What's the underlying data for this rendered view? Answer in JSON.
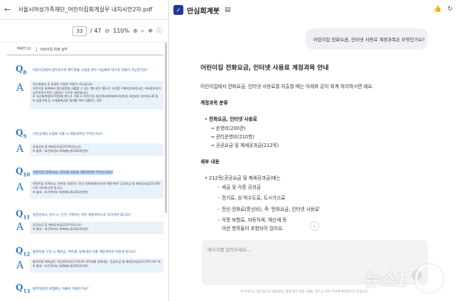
{
  "pdf": {
    "back_icon": "arrow-left-icon",
    "file_name": "서울시여성가족재단_어린이집회계실무 내치시안2차.pdf",
    "page_current": "33",
    "page_total": "/ 47",
    "zoom": "110%",
    "doc_header": {
      "part": "PART 02",
      "section": "어린이집 회계 실무"
    },
    "items": [
      {
        "q": "8",
        "question": "어린이집에서 업무용으로 핸드폰을 사용할 경우 이용료로 지기과 지출이 가능한가요?",
        "answer": [
          "안산회에서 휴 휴대폰 이용료 이용이 가능합니다.",
          "어린이집 회계에서 할인용품을 지출할 수 있는 핸드폰은 별도로 기기를 구매하신에게 되는 가비관리자가",
          "업무목적으로만 사용하는 기기로 제한됩니다.",
          "※ 지신회계에(271항)에 핸드폰 구매 시 어린이집 개선(특하회에회이리면)에 포함되어 관리하도록 합",
          "※ 상품구매 등 시계결제금을 협의를 하여 지출하는 경우"
        ]
      },
      {
        "q": "9",
        "question": "안전공제회 보험료 지출 시 계정과목은 무엇인가요?",
        "answer": [
          "공과금의 및 제세공과금(212목)입니다.",
          "※ 출처 : 보건복지부 회계매뉴얼(2024년판)"
        ]
      },
      {
        "q": "10",
        "question": "어린이집 전화요금, 인터넷 사용료 계정과목은 무엇인가요?",
        "answer": [
          "어린이집 전화요금, 인터넷 사용료는 전산 전화회(통신비)로 예산하여 '공공요금 및 제세공과금(212목)'",
          "으로 처리하시면 됩니다.",
          "※ 출처 : 보건복지부 회계매뉴얼(2024년판)"
        ]
      },
      {
        "q": "11",
        "question": "정전당비소 설치 시, 인건 구매하는 어떤 계정과목으로 처리하면 되나요?",
        "answer": [
          "공공요금 및 제세공과금(212목)입니다.",
          "※ 출처 : 보건복지부 회계매뉴얼(2024년판)"
        ]
      },
      {
        "q": "12",
        "question": "통학차량 구입 시 제반금, 취득세, 등록세의 지출 계정과목은 어떻게 되나요?",
        "answer": [
          "통학차량 계약금은 '자산취득비(271목)로 취득세와 등록세는 '공공요금 및 제세공과금(212목)'으로 처리",
          "※ 출처 : 보건복지부 회계매뉴얼(2024년판)"
        ]
      },
      {
        "q": "13",
        "question": "통학차량의 보험료는 지출비 지출인가요?",
        "answer": []
      }
    ]
  },
  "chat": {
    "app_title": "안심회계봇",
    "user_question": "어린이집 전화요금, 인터넷 사용료 계정과목은 무엇인가요?",
    "answer": {
      "title": "어린이집 전화요금, 인터넷 사용료 계정과목 안내",
      "intro": "어린이집에서 전화요금, 인터넷 사용료를 지출할 때는 아래와 같이 회계 처리하시면 돼요.",
      "category_heading": "계정과목 분류",
      "category_bullet": "전화요금, 인터넷 사용료",
      "category_items": [
        "→ 운영비(200관)",
        "→ 관리운영비(210항)",
        "→ 공공요금 및 제세공과금(212목)"
      ],
      "detail_heading": "세부 내용",
      "detail_bullet": "212목(공공요금 및 제세공과금)에는",
      "detail_items": [
        "세금 및 각종 공과금",
        "전기료, 상·하수도료, 도시가스료",
        "전신·전화료(통신비), 즉 '전화요금, 인터넷 사용료'",
        "각종 보험료, 자동차세, 재산세 등",
        "이런 항목들이 포함되어 있어요."
      ]
    },
    "input_placeholder": "메시지를 입력하세요...",
    "footer_note": "이 서비스는 참고용으로 제공되며, 실제 업무 적용 시에는 반드시 관련 부서에 확인하시기 바랍니다.",
    "watermark": "뉴스1"
  }
}
